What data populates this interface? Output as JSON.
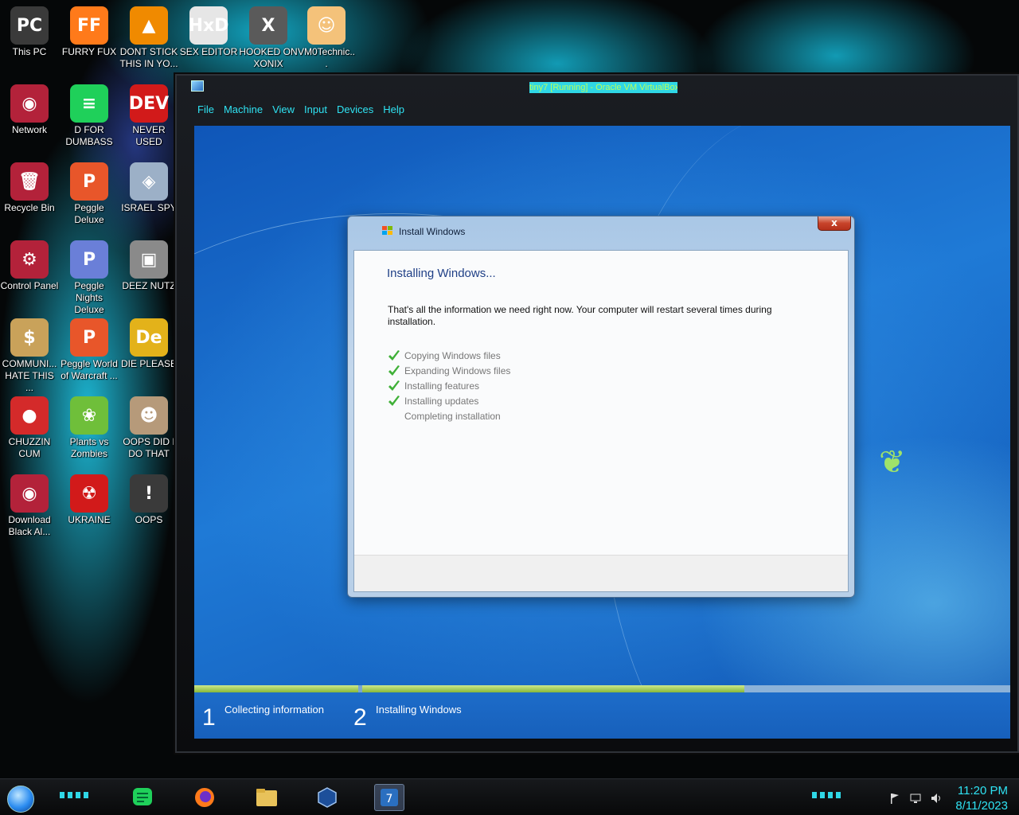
{
  "desktop": {
    "icons": [
      {
        "label": "This PC",
        "icon": "this-pc-icon",
        "color": "#3a3a3a"
      },
      {
        "label": "FURRY FUX",
        "icon": "firefox-icon",
        "color": "#ff7a1a"
      },
      {
        "label": "DONT STICK THIS IN YO...",
        "icon": "vlc-icon",
        "color": "#f08a00"
      },
      {
        "label": "SEX EDITOR",
        "icon": "hxd-icon",
        "color": "#e6e6e6"
      },
      {
        "label": "HOOKED ON XONIX",
        "icon": "xonix-icon",
        "color": "#5a5a5a"
      },
      {
        "label": "VM0Technic...",
        "icon": "doctor-icon",
        "color": "#f4c27a"
      },
      {
        "label": "Network",
        "icon": "network-icon",
        "color": "#b3223a"
      },
      {
        "label": "D FOR DUMBASS",
        "icon": "notes-icon",
        "color": "#1fd05a"
      },
      {
        "label": "NEVER USED",
        "icon": "devcpp-icon",
        "color": "#d21a1a"
      },
      {
        "label": "Recycle Bin",
        "icon": "recycle-bin-icon",
        "color": "#b3223a"
      },
      {
        "label": "Peggle Deluxe",
        "icon": "peggle-icon",
        "color": "#e8562a"
      },
      {
        "label": "ISRAEL SPY",
        "icon": "spy-icon",
        "color": "#9cb0c7"
      },
      {
        "label": "Control Panel",
        "icon": "control-panel-icon",
        "color": "#b3223a"
      },
      {
        "label": "Peggle Nights Deluxe",
        "icon": "peggle-nights-icon",
        "color": "#6a7fd8"
      },
      {
        "label": "DEEZ NUTZ",
        "icon": "windows-stack-icon",
        "color": "#8a8a8a"
      },
      {
        "label": "COMMUNI... HATE THIS ...",
        "icon": "money-bag-icon",
        "color": "#c9a25a"
      },
      {
        "label": "Peggle World of Warcraft ...",
        "icon": "peggle-wow-icon",
        "color": "#e8562a"
      },
      {
        "label": "DIE PLEASE",
        "icon": "de-icon",
        "color": "#e3b21a"
      },
      {
        "label": "CHUZZIN CUM",
        "icon": "chuzzle-icon",
        "color": "#d42a2a"
      },
      {
        "label": "Plants vs Zombies",
        "icon": "pvz-icon",
        "color": "#6fbf3a"
      },
      {
        "label": "OOPS DID I DO THAT",
        "icon": "portrait-icon",
        "color": "#b69a7a"
      },
      {
        "label": "Download Black Al...",
        "icon": "download-icon",
        "color": "#b3223a"
      },
      {
        "label": "UKRAINE",
        "icon": "radiation-icon",
        "color": "#d21a1a"
      },
      {
        "label": "OOPS",
        "icon": "oops-icon",
        "color": "#3a3a3a"
      }
    ],
    "icon_glyphs": [
      "PC",
      "FF",
      "▲",
      "HxD",
      "X",
      "☺",
      "◉",
      "≡",
      "DEV",
      "🗑",
      "P",
      "◈",
      "⚙",
      "P",
      "▣",
      "$",
      "P",
      "De",
      "●",
      "❀",
      "☻",
      "◉",
      "☢",
      "!"
    ]
  },
  "vbox": {
    "title": "tiny7 [Running] - Oracle VM VirtualBox",
    "menu": [
      "File",
      "Machine",
      "View",
      "Input",
      "Devices",
      "Help"
    ],
    "accent": "#2fe3f3"
  },
  "setup": {
    "dialog_title": "Install Windows",
    "heading": "Installing Windows...",
    "body": "That's all the information we need right now. Your computer will restart several times during installation.",
    "close_label": "x",
    "tasks": [
      {
        "label": "Copying Windows files",
        "done": true
      },
      {
        "label": "Expanding Windows files",
        "done": true
      },
      {
        "label": "Installing features",
        "done": true
      },
      {
        "label": "Installing updates",
        "done": true
      },
      {
        "label": "Completing installation",
        "done": false
      }
    ],
    "steps": [
      {
        "num": "1",
        "label": "Collecting information"
      },
      {
        "num": "2",
        "label": "Installing Windows"
      }
    ],
    "progress_step2": 0.59
  },
  "taskbar": {
    "apps": [
      "notes-app-icon",
      "firefox-icon",
      "file-explorer-icon",
      "virtualbox-icon",
      "win7-vm-icon"
    ],
    "tray": [
      "flag-icon",
      "network-tray-icon",
      "volume-icon"
    ],
    "time": "11:20 PM",
    "date": "8/11/2023"
  }
}
